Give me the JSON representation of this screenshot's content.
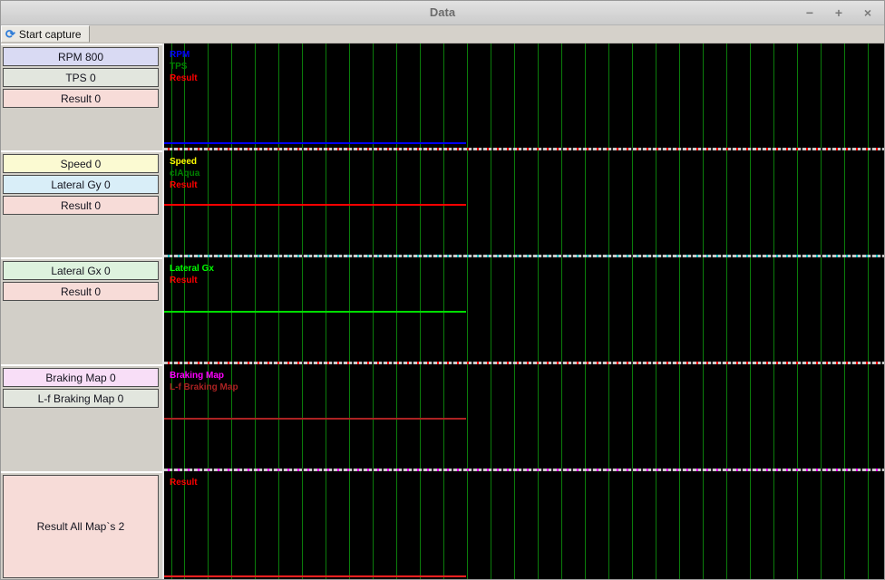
{
  "window": {
    "title": "Data",
    "controls": {
      "minimize": "−",
      "maximize": "+",
      "close": "×"
    }
  },
  "toolbar": {
    "start_capture_label": "Start capture",
    "icon": "capture-refresh-icon",
    "icon_glyph": "⟳"
  },
  "sidebar": {
    "groups": [
      {
        "panels": [
          {
            "label": "RPM 800",
            "bg": "#d9daf3"
          },
          {
            "label": "TPS 0",
            "bg": "#e2e6de"
          },
          {
            "label": "Result 0",
            "bg": "#f7dcd8"
          }
        ]
      },
      {
        "panels": [
          {
            "label": "Speed 0",
            "bg": "#fbfad2"
          },
          {
            "label": "Lateral Gy 0",
            "bg": "#d9eef8"
          },
          {
            "label": "Result 0",
            "bg": "#f7dcd8"
          }
        ]
      },
      {
        "panels": [
          {
            "label": "Lateral Gx 0",
            "bg": "#def2de"
          },
          {
            "label": "Result 0",
            "bg": "#f7dcd8"
          }
        ]
      },
      {
        "panels": [
          {
            "label": "Braking Map 0",
            "bg": "#f8def7"
          },
          {
            "label": "L-f Braking Map 0",
            "bg": "#e2e6de"
          }
        ]
      },
      {
        "panels": [
          {
            "label": "Result All Map`s 2",
            "bg": "#f7dcd8",
            "fill": true
          }
        ]
      }
    ],
    "filler_color": "#d2cfc8"
  },
  "chart_data": [
    {
      "type": "line",
      "name": "rpm-tps-result",
      "legend": [
        {
          "label": "RPM",
          "color": "#0000ff"
        },
        {
          "label": "TPS",
          "color": "#008000"
        },
        {
          "label": "Result",
          "color": "#ff0000"
        }
      ],
      "background": "#000000",
      "gridlines": {
        "orientation": "vertical",
        "color": "#0b7c0b",
        "spacing_px": 26
      },
      "traces": [
        {
          "name": "RPM",
          "value": 800,
          "color": "#0000ff",
          "y_frac": 0.93,
          "x_end_frac": 0.42
        }
      ],
      "zero_traces": [
        "TPS",
        "Result"
      ],
      "baseline_accent": "#ff0000"
    },
    {
      "type": "line",
      "name": "speed-claqua-result",
      "legend": [
        {
          "label": "Speed",
          "color": "#ffff00"
        },
        {
          "label": "clAqua",
          "color": "#008000"
        },
        {
          "label": "Result",
          "color": "#ff0000"
        }
      ],
      "background": "#000000",
      "gridlines": {
        "orientation": "vertical",
        "color": "#0b7c0b",
        "spacing_px": 26
      },
      "traces": [
        {
          "name": "Result",
          "value": 0,
          "color": "#ff0000",
          "y_frac": 0.508,
          "x_end_frac": 0.42
        }
      ],
      "zero_traces": [
        "clAqua"
      ],
      "baseline_accent": "#00b8b8"
    },
    {
      "type": "line",
      "name": "lateral-gx-result",
      "legend": [
        {
          "label": "Lateral Gx",
          "color": "#00ff00"
        },
        {
          "label": "Result",
          "color": "#ff0000"
        }
      ],
      "background": "#000000",
      "gridlines": {
        "orientation": "vertical",
        "color": "#0b7c0b",
        "spacing_px": 26
      },
      "traces": [
        {
          "name": "Lateral Gx",
          "value": 0,
          "color": "#00dd00",
          "y_frac": 0.508,
          "x_end_frac": 0.42
        }
      ],
      "zero_traces": [
        "Result"
      ],
      "baseline_accent": "#ff0000"
    },
    {
      "type": "line",
      "name": "braking-maps",
      "legend": [
        {
          "label": "Braking Map",
          "color": "#ff00ff"
        },
        {
          "label": "L-f Braking Map",
          "color": "#aa2222"
        }
      ],
      "background": "#000000",
      "gridlines": {
        "orientation": "vertical",
        "color": "#0b7c0b",
        "spacing_px": 26
      },
      "traces": [
        {
          "name": "L-f Braking Map",
          "value": 0,
          "color": "#aa2222",
          "y_frac": 0.51,
          "x_end_frac": 0.42
        }
      ],
      "zero_traces": [
        "Braking Map"
      ],
      "baseline_accent": "#ff00ff"
    },
    {
      "type": "line",
      "name": "result-all-maps",
      "legend": [
        {
          "label": "Result",
          "color": "#ff0000"
        }
      ],
      "background": "#000000",
      "gridlines": {
        "orientation": "vertical",
        "color": "#0b7c0b",
        "spacing_px": 26
      },
      "traces": [
        {
          "name": "Result",
          "value": 2,
          "color": "#ff2020",
          "y_frac": 0.967,
          "x_end_frac": 0.42
        }
      ],
      "zero_traces": [],
      "baseline_accent": null
    }
  ]
}
